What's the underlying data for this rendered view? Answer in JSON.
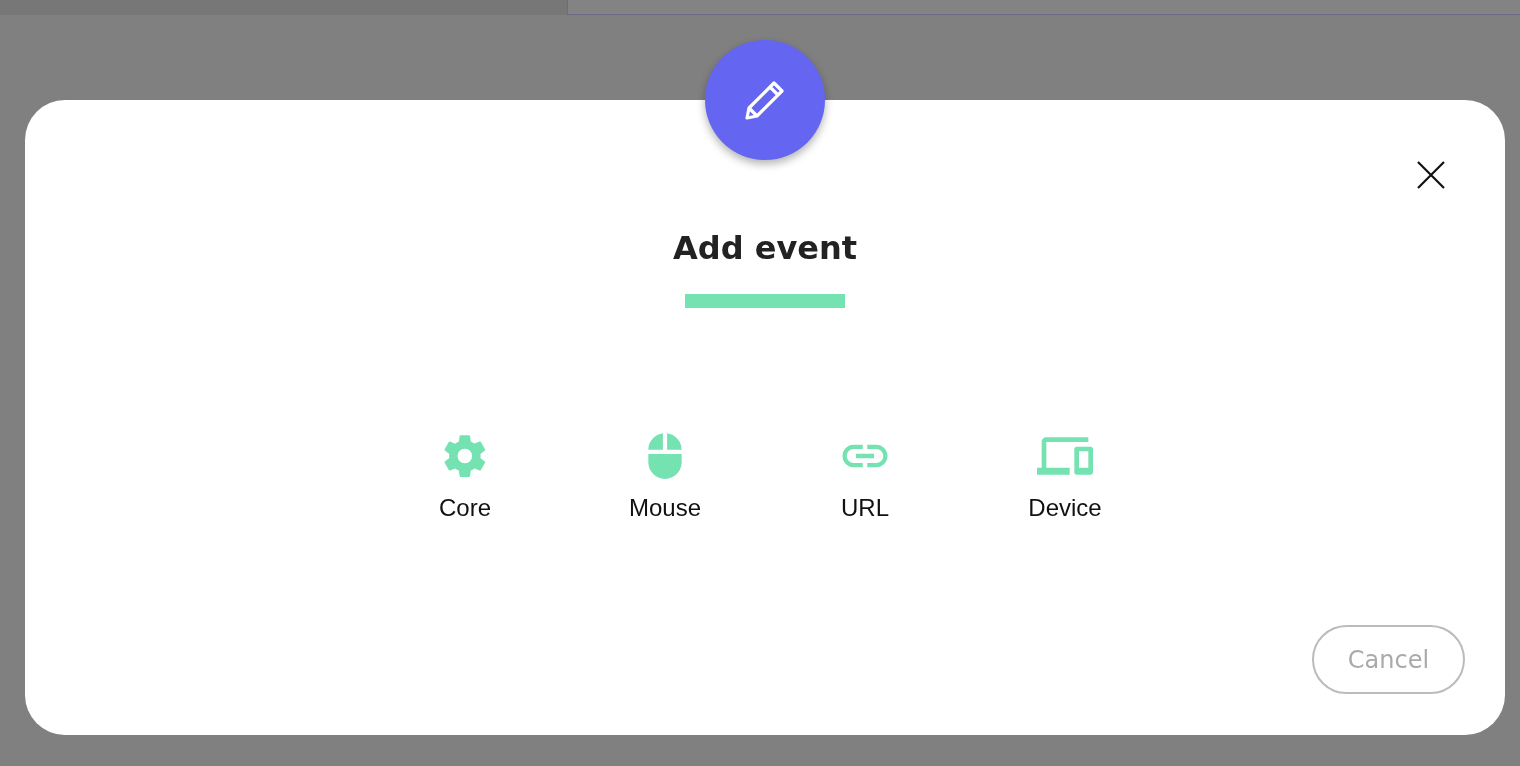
{
  "dialog": {
    "title": "Add event",
    "options": [
      {
        "kind": "core",
        "label": "Core"
      },
      {
        "kind": "mouse",
        "label": "Mouse"
      },
      {
        "kind": "url",
        "label": "URL"
      },
      {
        "kind": "device",
        "label": "Device"
      }
    ],
    "cancel_button": "Cancel"
  }
}
